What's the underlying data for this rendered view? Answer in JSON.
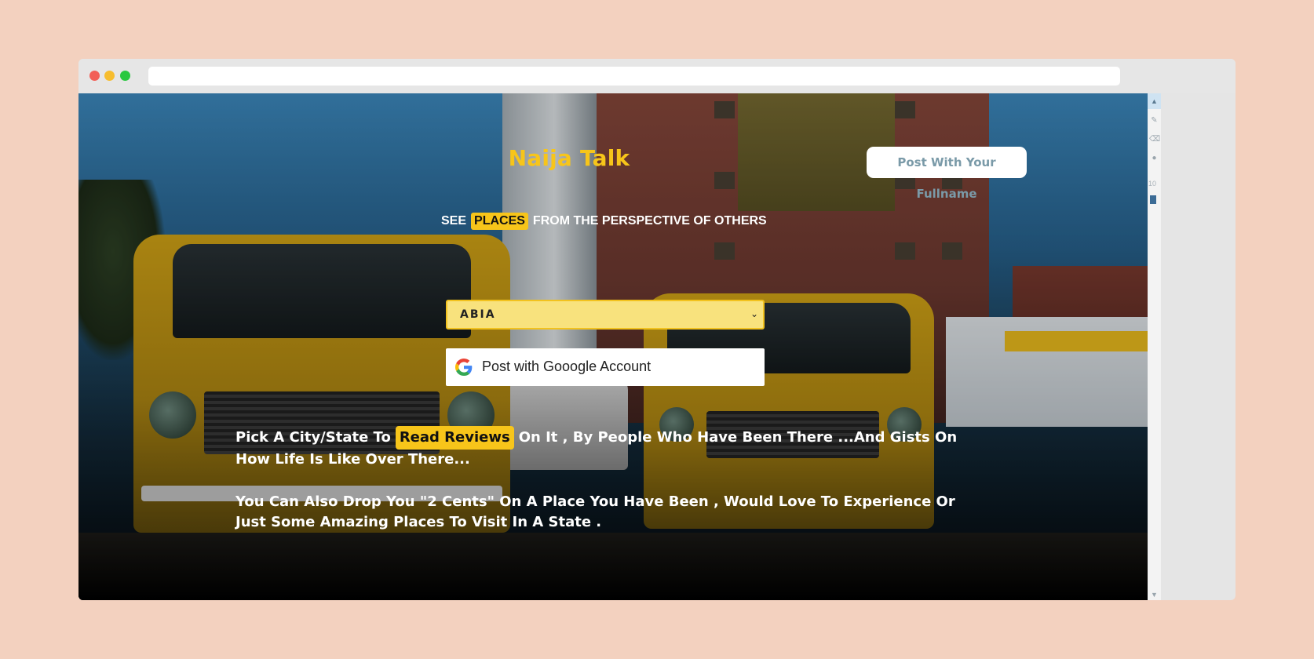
{
  "site": {
    "title": "Naija Talk",
    "post_fullname_label": "Post With Your Fullname"
  },
  "tagline": {
    "prefix": "SEE",
    "highlight": "PLACES",
    "suffix": "FROM THE PERSPECTIVE OF OTHERS"
  },
  "state_select": {
    "selected": "ABIA",
    "options": [
      "ABIA"
    ]
  },
  "google_button": {
    "label": "Post with Gooogle Account",
    "icon": "google-icon"
  },
  "intro": {
    "p1_before": "Pick A City/State To",
    "p1_highlight": "Read Reviews",
    "p1_after": "On It , By People Who Have Been There ...And Gists On How Life Is Like Over There...",
    "p2": "You Can Also Drop You \"2 Cents\" On A Place You Have Been , Would Love To Experience Or Just Some Amazing Places To Visit In A State ."
  },
  "side_toolbar": {
    "number": "10"
  },
  "colors": {
    "accent": "#f7c51a",
    "page_background": "#f3d1bf",
    "button_text": "#7a9aa8"
  }
}
